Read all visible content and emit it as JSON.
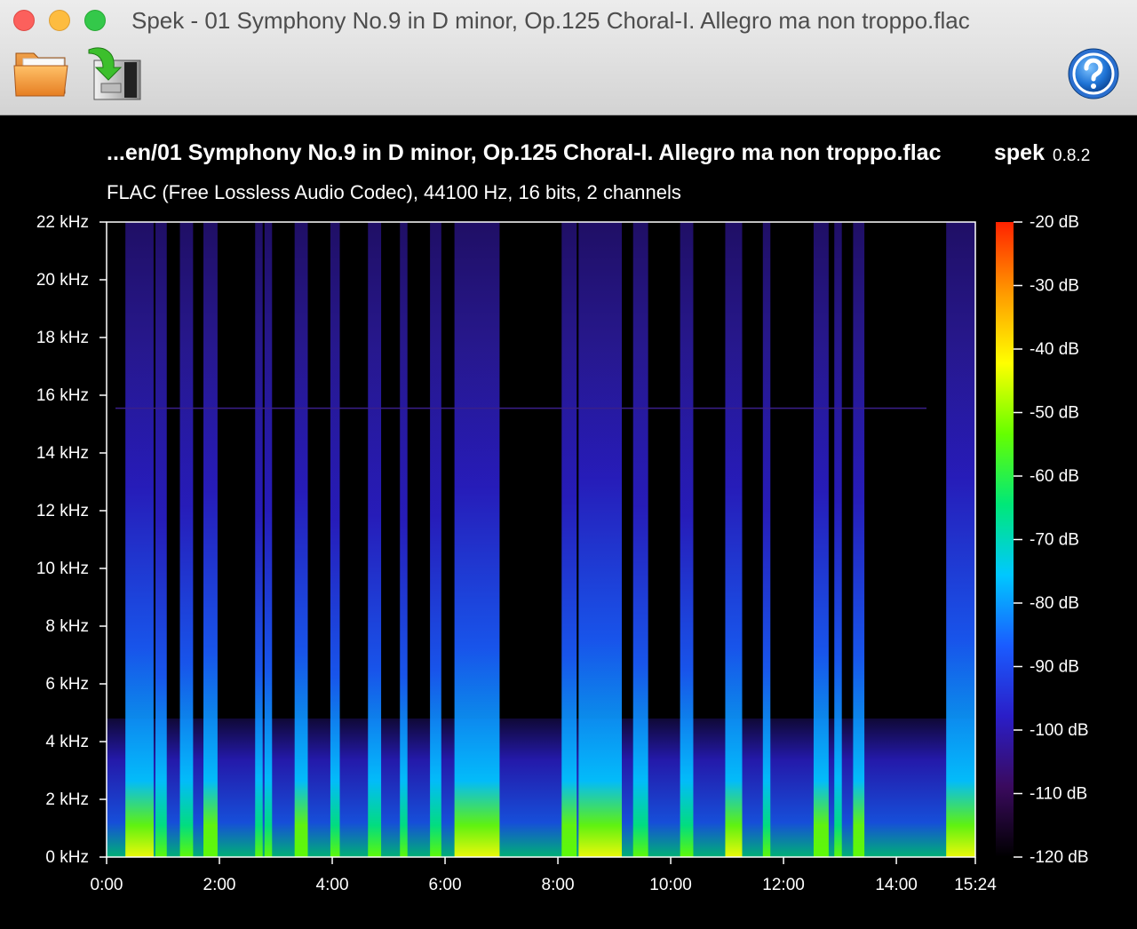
{
  "window": {
    "title": "Spek - 01 Symphony No.9 in D minor, Op.125 Choral-I. Allegro ma non troppo.flac"
  },
  "toolbar": {
    "open_icon": "folder-icon",
    "save_icon": "save-image-icon",
    "help_icon": "help-icon"
  },
  "header": {
    "file_title": "...en/01 Symphony No.9 in D minor, Op.125 Choral-I. Allegro ma non troppo.flac",
    "app_name": "spek",
    "app_version": "0.8.2",
    "file_info": "FLAC (Free Lossless Audio Codec), 44100 Hz, 16 bits, 2 channels"
  },
  "chart_data": {
    "type": "heatmap",
    "x_ticks": [
      {
        "label": "0:00",
        "seconds": 0
      },
      {
        "label": "2:00",
        "seconds": 120
      },
      {
        "label": "4:00",
        "seconds": 240
      },
      {
        "label": "6:00",
        "seconds": 360
      },
      {
        "label": "8:00",
        "seconds": 480
      },
      {
        "label": "10:00",
        "seconds": 600
      },
      {
        "label": "12:00",
        "seconds": 720
      },
      {
        "label": "14:00",
        "seconds": 840
      },
      {
        "label": "15:24",
        "seconds": 924
      }
    ],
    "xlim_seconds": [
      0,
      924
    ],
    "y_ticks": [
      {
        "label": "0 kHz",
        "khz": 0
      },
      {
        "label": "2 kHz",
        "khz": 2
      },
      {
        "label": "4 kHz",
        "khz": 4
      },
      {
        "label": "6 kHz",
        "khz": 6
      },
      {
        "label": "8 kHz",
        "khz": 8
      },
      {
        "label": "10 kHz",
        "khz": 10
      },
      {
        "label": "12 kHz",
        "khz": 12
      },
      {
        "label": "14 kHz",
        "khz": 14
      },
      {
        "label": "16 kHz",
        "khz": 16
      },
      {
        "label": "18 kHz",
        "khz": 18
      },
      {
        "label": "20 kHz",
        "khz": 20
      },
      {
        "label": "22 kHz",
        "khz": 22
      }
    ],
    "ylim_khz": [
      0,
      22
    ],
    "db_ticks": [
      {
        "label": "-20 dB",
        "db": -20
      },
      {
        "label": "-30 dB",
        "db": -30
      },
      {
        "label": "-40 dB",
        "db": -40
      },
      {
        "label": "-50 dB",
        "db": -50
      },
      {
        "label": "-60 dB",
        "db": -60
      },
      {
        "label": "-70 dB",
        "db": -70
      },
      {
        "label": "-80 dB",
        "db": -80
      },
      {
        "label": "-90 dB",
        "db": -90
      },
      {
        "label": "-100 dB",
        "db": -100
      },
      {
        "label": "-110 dB",
        "db": -110
      },
      {
        "label": "-120 dB",
        "db": -120
      }
    ],
    "db_range": [
      -120,
      -20
    ],
    "colormap": [
      "#000000",
      "#3a0a5e",
      "#2a1ec8",
      "#1a5cff",
      "#00c8ff",
      "#00e878",
      "#66ff00",
      "#ffff00",
      "#ff9900",
      "#ff2200"
    ],
    "loud_bands": [
      {
        "start_s": 20,
        "end_s": 50,
        "level": 0.9
      },
      {
        "start_s": 52,
        "end_s": 64,
        "level": 0.55
      },
      {
        "start_s": 78,
        "end_s": 92,
        "level": 0.7
      },
      {
        "start_s": 103,
        "end_s": 118,
        "level": 0.85
      },
      {
        "start_s": 158,
        "end_s": 166,
        "level": 0.6
      },
      {
        "start_s": 168,
        "end_s": 176,
        "level": 0.65
      },
      {
        "start_s": 200,
        "end_s": 214,
        "level": 0.85
      },
      {
        "start_s": 238,
        "end_s": 248,
        "level": 0.55
      },
      {
        "start_s": 278,
        "end_s": 292,
        "level": 0.6
      },
      {
        "start_s": 312,
        "end_s": 320,
        "level": 0.55
      },
      {
        "start_s": 344,
        "end_s": 356,
        "level": 0.6
      },
      {
        "start_s": 370,
        "end_s": 418,
        "level": 0.9
      },
      {
        "start_s": 484,
        "end_s": 500,
        "level": 0.8
      },
      {
        "start_s": 502,
        "end_s": 548,
        "level": 1.0
      },
      {
        "start_s": 560,
        "end_s": 576,
        "level": 0.7
      },
      {
        "start_s": 610,
        "end_s": 624,
        "level": 0.6
      },
      {
        "start_s": 658,
        "end_s": 676,
        "level": 0.9
      },
      {
        "start_s": 698,
        "end_s": 706,
        "level": 0.65
      },
      {
        "start_s": 752,
        "end_s": 768,
        "level": 0.85
      },
      {
        "start_s": 774,
        "end_s": 782,
        "level": 0.75
      },
      {
        "start_s": 794,
        "end_s": 806,
        "level": 0.8
      },
      {
        "start_s": 893,
        "end_s": 924,
        "level": 1.0
      }
    ]
  }
}
